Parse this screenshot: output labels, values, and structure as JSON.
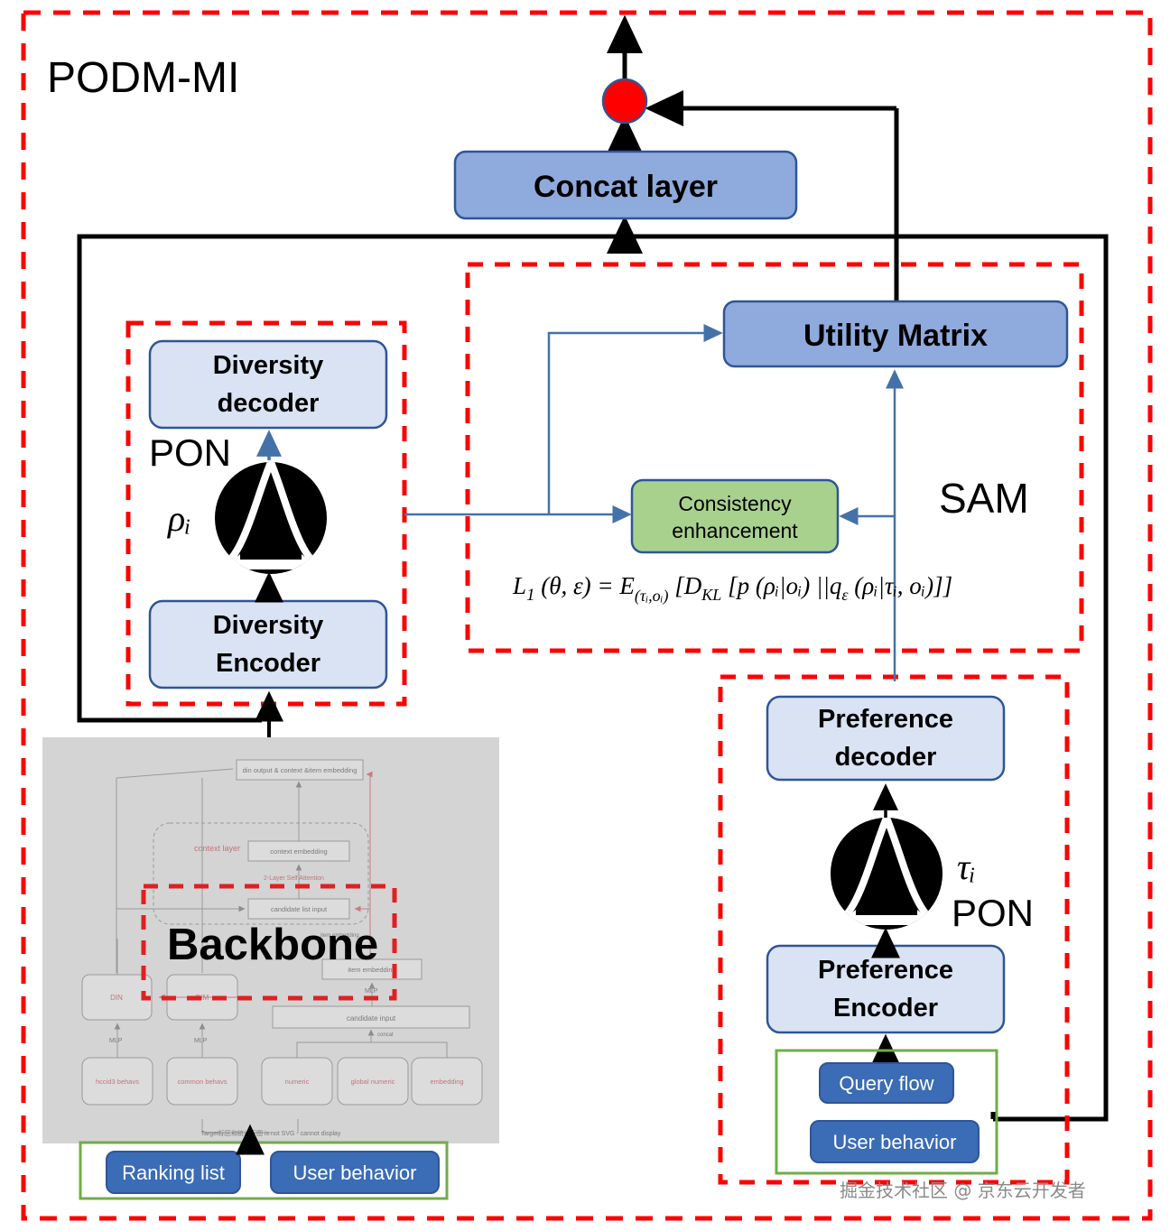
{
  "diagram": {
    "title": "PODM-MI",
    "modules": {
      "pon_left_label": "PON",
      "pon_left_symbol": "ρᵢ",
      "pon_right_label": "PON",
      "pon_right_symbol": "τᵢ",
      "sam_label": "SAM",
      "backbone_label": "Backbone"
    },
    "boxes": {
      "concat_layer": "Concat layer",
      "utility_matrix": "Utility Matrix",
      "consistency_enhancement_line1": "Consistency",
      "consistency_enhancement_line2": "enhancement",
      "diversity_decoder_line1": "Diversity",
      "diversity_decoder_line2": "decoder",
      "diversity_encoder_line1": "Diversity",
      "diversity_encoder_line2": "Encoder",
      "preference_decoder_line1": "Preference",
      "preference_decoder_line2": "decoder",
      "preference_encoder_line1": "Preference",
      "preference_encoder_line2": "Encoder",
      "query_flow": "Query flow",
      "user_behavior_right": "User behavior",
      "ranking_list": "Ranking list",
      "user_behavior_left": "User behavior"
    },
    "formula": "L₁ (θ, ε) = E(τᵢ,ₒᵢ) [Dₖₗ [p (ρᵢ|oᵢ) ||qε (ρᵢ|τᵢ, oᵢ)]]",
    "formula_parts": {
      "L": "L",
      "L_sub": "1",
      "args": " (θ, ε) = ",
      "E": "E",
      "E_sub": "(τᵢ,oᵢ)",
      "bracket1": " [",
      "D": "D",
      "D_sub": "KL",
      "bracket2": " [",
      "p": "p",
      "p_args": " (ρᵢ|oᵢ) ",
      "norm": "||",
      "q": "q",
      "q_sub": "ε",
      "q_args": " (ρᵢ|τᵢ, oᵢ)",
      "close": "]]"
    },
    "backbone_internal": {
      "din_output": "din output & context &item embedding",
      "context_layer": "context layer",
      "context_embedding": "context embedding",
      "self_attention": "2-Layer Self Attention",
      "candidate_list_input": "candidate list input",
      "item_embedding_small": "item embedding",
      "item_embedding": "item embedding",
      "candidate_input": "candidate input",
      "concat_tiny": "concat",
      "din": "DIN",
      "dim": "DIM",
      "mlp1": "MLP",
      "mlp2": "MLP",
      "mlp3": "MLP",
      "hccid3_behavs": "hccid3 behavs",
      "common_behavs": "common behavs",
      "numeric": "numeric",
      "global_numeric": "global numeric",
      "embedding": "embedding",
      "footer": "Target标区和统计下图 is not SVG - cannot display"
    },
    "watermark": "掘金技术社区 @ 京东云开发者",
    "colors": {
      "outer_dashed": "#ff0000",
      "module_dashed": "#ff0000",
      "deep_blue_box": "#8faadc",
      "light_blue_box": "#dae3f3",
      "green_box": "#a9d18e",
      "input_blue_box": "#3b6cb6",
      "green_group_border": "#70ad47",
      "node_red": "#ff0000",
      "backbone_bg": "#d4d4d4",
      "blue_arrow": "#4472a8",
      "black": "#000000"
    }
  }
}
